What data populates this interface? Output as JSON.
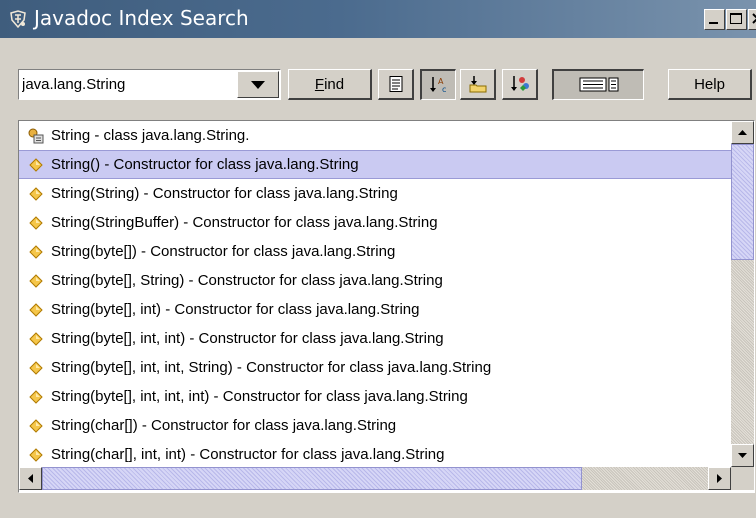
{
  "window": {
    "title": "Javadoc Index Search",
    "controls": [
      "minimize-icon",
      "maximize-icon",
      "close-icon"
    ]
  },
  "toolbar": {
    "search_value": "java.lang.String",
    "find_label_underlined": "F",
    "find_label_rest": "ind",
    "help_label": "Help",
    "icon_buttons": [
      "source-view-icon",
      "sort-alphabetical-icon",
      "package-folder-icon",
      "sort-by-type-icon",
      "details-view-icon"
    ]
  },
  "results": [
    {
      "icon": "class-icon",
      "text": "String - class java.lang.String.",
      "selected": false
    },
    {
      "icon": "constructor-icon",
      "text": "String() - Constructor for class java.lang.String",
      "selected": true
    },
    {
      "icon": "constructor-icon",
      "text": "String(String) - Constructor for class java.lang.String",
      "selected": false
    },
    {
      "icon": "constructor-icon",
      "text": "String(StringBuffer) - Constructor for class java.lang.String",
      "selected": false
    },
    {
      "icon": "constructor-icon",
      "text": "String(byte[]) - Constructor for class java.lang.String",
      "selected": false
    },
    {
      "icon": "constructor-icon",
      "text": "String(byte[], String) - Constructor for class java.lang.String",
      "selected": false
    },
    {
      "icon": "constructor-icon",
      "text": "String(byte[], int) - Constructor for class java.lang.String",
      "selected": false
    },
    {
      "icon": "constructor-icon",
      "text": "String(byte[], int, int) - Constructor for class java.lang.String",
      "selected": false
    },
    {
      "icon": "constructor-icon",
      "text": "String(byte[], int, int, String) - Constructor for class java.lang.String",
      "selected": false
    },
    {
      "icon": "constructor-icon",
      "text": "String(byte[], int, int, int) - Constructor for class java.lang.String",
      "selected": false
    },
    {
      "icon": "constructor-icon",
      "text": "String(char[]) - Constructor for class java.lang.String",
      "selected": false
    },
    {
      "icon": "constructor-icon",
      "text": "String(char[], int, int) - Constructor for class java.lang.String",
      "selected": false
    },
    {
      "icon": "constructor-icon",
      "text": "",
      "selected": false
    }
  ]
}
